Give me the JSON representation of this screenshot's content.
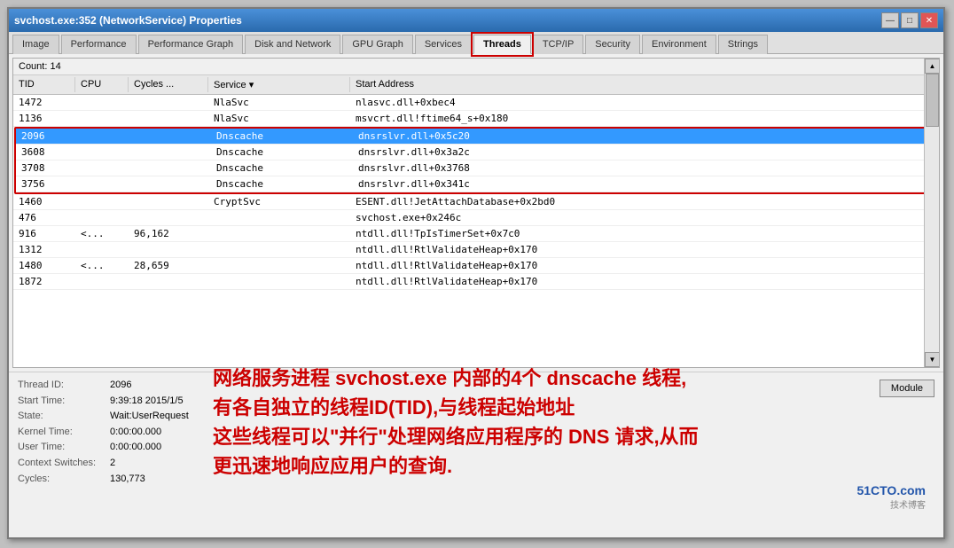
{
  "window": {
    "title": "svchost.exe:352 (NetworkService) Properties",
    "min_label": "—",
    "max_label": "□",
    "close_label": "✕"
  },
  "tabs": [
    {
      "id": "image",
      "label": "Image"
    },
    {
      "id": "performance",
      "label": "Performance"
    },
    {
      "id": "performance-graph",
      "label": "Performance Graph"
    },
    {
      "id": "disk-network",
      "label": "Disk and Network"
    },
    {
      "id": "gpu-graph",
      "label": "GPU Graph"
    },
    {
      "id": "services",
      "label": "Services"
    },
    {
      "id": "threads",
      "label": "Threads",
      "active": true
    },
    {
      "id": "tcp-ip",
      "label": "TCP/IP"
    },
    {
      "id": "security",
      "label": "Security"
    },
    {
      "id": "environment",
      "label": "Environment"
    },
    {
      "id": "strings",
      "label": "Strings"
    }
  ],
  "count": "Count:  14",
  "table": {
    "headers": [
      "TID",
      "CPU",
      "Cycles ...",
      "Service",
      "Start Address"
    ],
    "rows": [
      {
        "tid": "1472",
        "cpu": "",
        "cycles": "",
        "service": "NlaSvc",
        "address": "nlasvc.dll+0xbec4",
        "selected": false
      },
      {
        "tid": "1136",
        "cpu": "",
        "cycles": "",
        "service": "NlaSvc",
        "address": "msvcrt.dll!ftime64_s+0x180",
        "selected": false
      },
      {
        "tid": "2096",
        "cpu": "",
        "cycles": "",
        "service": "Dnscache",
        "address": "dnsrslvr.dll+0x5c20",
        "selected": true
      },
      {
        "tid": "3608",
        "cpu": "",
        "cycles": "",
        "service": "Dnscache",
        "address": "dnsrslvr.dll+0x3a2c",
        "selected": false
      },
      {
        "tid": "3708",
        "cpu": "",
        "cycles": "",
        "service": "Dnscache",
        "address": "dnsrslvr.dll+0x3768",
        "selected": false
      },
      {
        "tid": "3756",
        "cpu": "",
        "cycles": "",
        "service": "Dnscache",
        "address": "dnsrslvr.dll+0x341c",
        "selected": false
      },
      {
        "tid": "1460",
        "cpu": "",
        "cycles": "",
        "service": "CryptSvc",
        "address": "ESENT.dll!JetAttachDatabase+0x2bd0",
        "selected": false
      },
      {
        "tid": "476",
        "cpu": "",
        "cycles": "",
        "service": "",
        "address": "svchost.exe+0x246c",
        "selected": false
      },
      {
        "tid": "916",
        "cpu": "<...",
        "cycles": "96,162",
        "service": "",
        "address": "ntdll.dll!TpIsTimerSet+0x7c0",
        "selected": false
      },
      {
        "tid": "1312",
        "cpu": "",
        "cycles": "",
        "service": "",
        "address": "ntdll.dll!RtlValidateHeap+0x170",
        "selected": false
      },
      {
        "tid": "1480",
        "cpu": "<...",
        "cycles": "28,659",
        "service": "",
        "address": "ntdll.dll!RtlValidateHeap+0x170",
        "selected": false
      },
      {
        "tid": "1872",
        "cpu": "",
        "cycles": "",
        "service": "",
        "address": "ntdll.dll!RtlValidateHeap+0x170",
        "selected": false
      }
    ]
  },
  "details": {
    "thread_id_label": "Thread ID:",
    "thread_id_value": "2096",
    "start_time_label": "Start Time:",
    "start_time_value": "9:39:18  2015/1/5",
    "state_label": "State:",
    "state_value": "Wait:UserRequest",
    "kernel_time_label": "Kernel Time:",
    "kernel_time_value": "0:00:00.000",
    "user_time_label": "User Time:",
    "user_time_value": "0:00:00.000",
    "context_switches_label": "Context Switches:",
    "context_switches_value": "2",
    "cycles_label": "Cycles:",
    "cycles_value": "130,773",
    "module_btn": "Module"
  },
  "annotation": {
    "line1": "网络服务进程 svchost.exe 内部的4个 dnscache 线程,",
    "line2": "有各自独立的线程ID(TID),与线程起始地址",
    "line3": "这些线程可以\"并行\"处理网络应用程序的 DNS 请求,从而",
    "line4": "更迅速地响应应用户的查询."
  },
  "watermark": {
    "site": "51CTO.com",
    "subtitle": "技术博客"
  }
}
